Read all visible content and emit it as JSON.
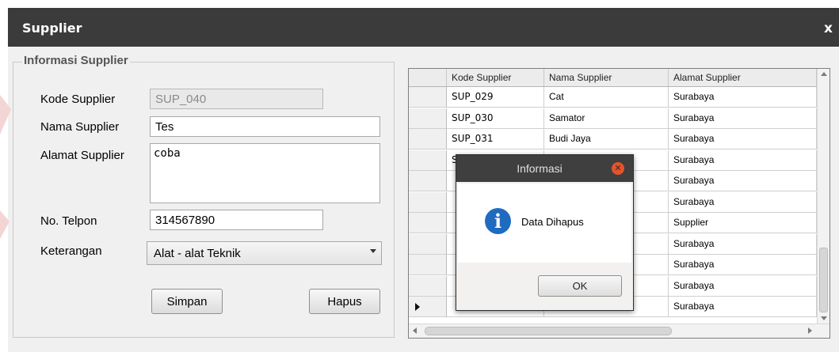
{
  "window": {
    "title": "Supplier",
    "close_label": "x"
  },
  "form": {
    "group_title": "Informasi Supplier",
    "kode_label": "Kode Supplier",
    "kode_value": "SUP_040",
    "nama_label": "Nama Supplier",
    "nama_value": "Tes",
    "alamat_label": "Alamat Supplier",
    "alamat_value": "coba",
    "telpon_label": "No. Telpon",
    "telpon_value": "314567890",
    "keterangan_label": "Keterangan",
    "keterangan_value": "Alat - alat Teknik",
    "simpan_label": "Simpan",
    "hapus_label": "Hapus"
  },
  "table": {
    "columns": [
      "Kode Supplier",
      "Nama Supplier",
      "Alamat Supplier"
    ],
    "rows": [
      [
        "SUP_029",
        "Cat",
        "Surabaya"
      ],
      [
        "SUP_030",
        "Samator",
        "Surabaya"
      ],
      [
        "SUP_031",
        "Budi Jaya",
        "Surabaya"
      ],
      [
        "S",
        "",
        "Surabaya"
      ],
      [
        "",
        "",
        "Surabaya"
      ],
      [
        "",
        "",
        "Surabaya"
      ],
      [
        "",
        "",
        "Supplier"
      ],
      [
        "",
        "",
        "Surabaya"
      ],
      [
        "",
        "",
        "Surabaya"
      ],
      [
        "",
        "",
        "Surabaya"
      ],
      [
        "",
        "",
        "Surabaya"
      ]
    ]
  },
  "dialog": {
    "title": "Informasi",
    "message": "Data Dihapus",
    "ok_label": "OK"
  },
  "colors": {
    "titlebar": "#3b3b3b",
    "dialog_title": "#3f3f3f",
    "dialog_close": "#e5532d",
    "info_icon": "#1f6bc0"
  },
  "icons": {
    "info": "info-icon",
    "close": "close-icon"
  }
}
